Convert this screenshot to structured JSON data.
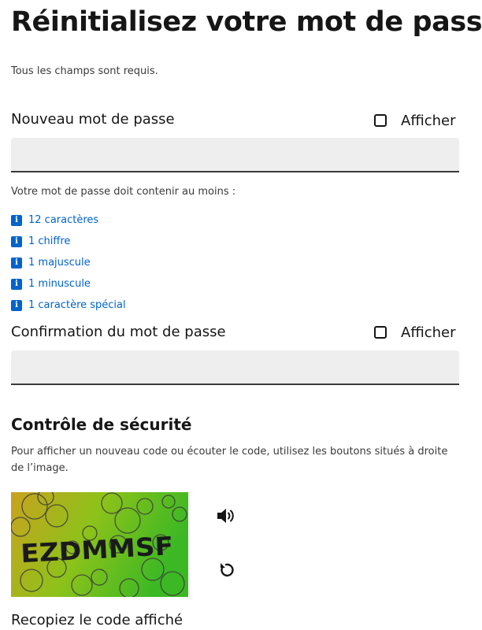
{
  "page": {
    "title": "Réinitialisez votre mot de passe",
    "required_note": "Tous les champs sont requis."
  },
  "new_password": {
    "label": "Nouveau mot de passe",
    "show_label": "Afficher",
    "value": ""
  },
  "password_rules": {
    "intro": "Votre mot de passe doit contenir au moins :",
    "items": [
      {
        "label": "12 caractères",
        "icon": "info-icon"
      },
      {
        "label": "1 chiffre",
        "icon": "info-icon"
      },
      {
        "label": "1 majuscule",
        "icon": "info-icon"
      },
      {
        "label": "1 minuscule",
        "icon": "info-icon"
      },
      {
        "label": "1 caractère spécial",
        "icon": "info-icon"
      }
    ]
  },
  "confirm_password": {
    "label": "Confirmation du mot de passe",
    "show_label": "Afficher",
    "value": ""
  },
  "security_check": {
    "title": "Contrôle de sécurité",
    "help": "Pour afficher un nouveau code ou écouter le code, utilisez les boutons situés à droite de l’image.",
    "captcha_code": "EZDMMSF",
    "audio_icon": "speaker-icon",
    "refresh_icon": "refresh-icon",
    "copy_label": "Recopiez le code affiché"
  },
  "colors": {
    "accent_blue": "#0063cb",
    "input_bg": "#eeeeee",
    "text": "#161616"
  }
}
